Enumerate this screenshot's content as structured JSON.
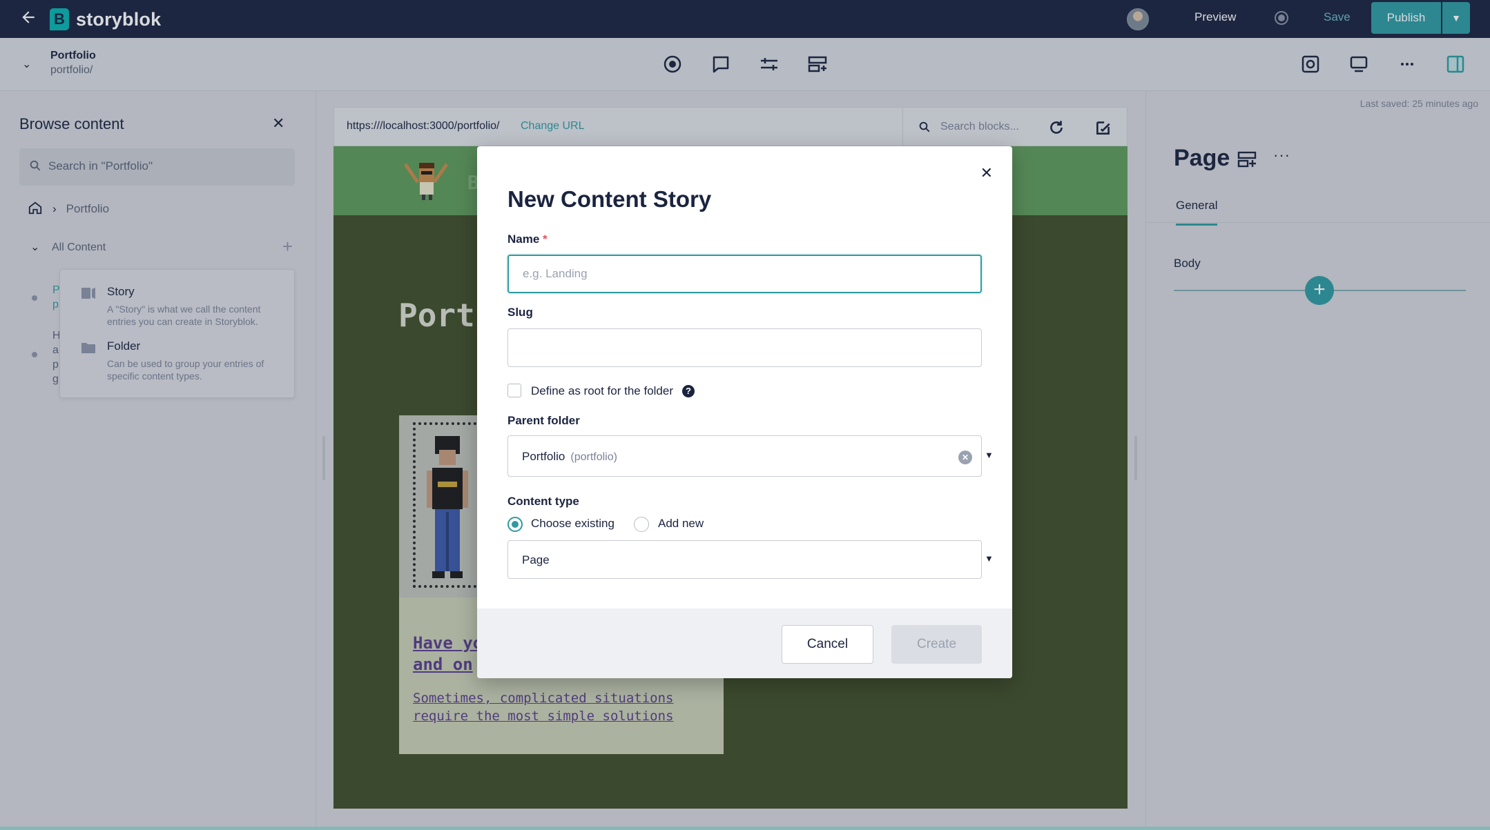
{
  "app": {
    "brand": "storyblok",
    "logo_letter": "B"
  },
  "topbar": {
    "preview_label": "Preview",
    "save_label": "Save",
    "publish_label": "Publish"
  },
  "story": {
    "name": "Portfolio",
    "slug": "portfolio/"
  },
  "browse": {
    "title": "Browse content",
    "search_placeholder": "Search in \"Portfolio\"",
    "breadcrumb": "Portfolio",
    "all_content_label": "All Content",
    "menu": [
      {
        "label": "Story",
        "description": "A \"Story\" is what we call the content entries you can create in Storyblok."
      },
      {
        "label": "Folder",
        "description": "Can be used to group your entries of specific content types."
      }
    ]
  },
  "preview_bar": {
    "url": "https:///localhost:3000/portfolio/",
    "change_url_label": "Change URL",
    "search_placeholder": "Search blocks..."
  },
  "site": {
    "heading": "Port",
    "brand_letter": "B",
    "card_title": "Have yo\nand on ",
    "card_subtitle": "Sometimes, complicated situations require the most simple solutions"
  },
  "right_panel": {
    "last_saved": "Last saved: 25 minutes ago",
    "title": "Page",
    "tab": "General",
    "body_label": "Body"
  },
  "modal": {
    "title": "New Content Story",
    "name_label": "Name",
    "name_required": "*",
    "name_placeholder": "e.g. Landing",
    "name_value": "",
    "slug_label": "Slug",
    "slug_value": "",
    "root_checkbox_label": "Define as root for the folder",
    "root_checked": false,
    "parent_label": "Parent folder",
    "parent_value": "Portfolio",
    "parent_hint": "(portfolio)",
    "content_type_label": "Content type",
    "radio_existing": "Choose existing",
    "radio_new": "Add new",
    "selected_radio": "Choose existing",
    "content_type_value": "Page",
    "cancel_label": "Cancel",
    "create_label": "Create"
  },
  "colors": {
    "topbar": "#1b243f",
    "accent": "#2f9aa0",
    "site_header": "#5f9a5a",
    "site_bg": "#404f29"
  }
}
